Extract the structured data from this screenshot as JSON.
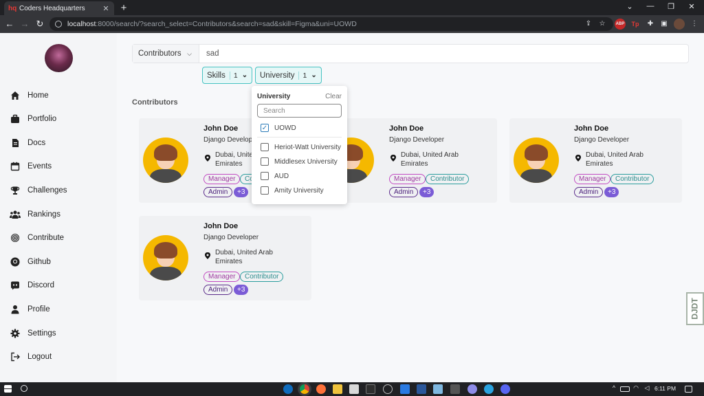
{
  "browser": {
    "tab_title": "Coders Headquarters",
    "tab_favicon": "hq",
    "url_host": "localhost",
    "url_rest": ":8000/search/?search_select=Contributors&search=sad&skill=Figma&uni=UOWD",
    "abp_label": "ABP",
    "tp_label": "Tp"
  },
  "sidebar": {
    "items": [
      {
        "label": "Home",
        "icon": "home-icon"
      },
      {
        "label": "Portfolio",
        "icon": "briefcase-icon"
      },
      {
        "label": "Docs",
        "icon": "document-icon"
      },
      {
        "label": "Events",
        "icon": "calendar-icon"
      },
      {
        "label": "Challenges",
        "icon": "trophy-icon"
      },
      {
        "label": "Rankings",
        "icon": "users-icon"
      },
      {
        "label": "Contribute",
        "icon": "fingerprint-icon"
      },
      {
        "label": "Github",
        "icon": "github-icon"
      },
      {
        "label": "Discord",
        "icon": "discord-icon"
      },
      {
        "label": "Profile",
        "icon": "person-icon"
      },
      {
        "label": "Settings",
        "icon": "gear-icon"
      },
      {
        "label": "Logout",
        "icon": "logout-icon"
      }
    ]
  },
  "search": {
    "select_value": "Contributors",
    "query": "sad"
  },
  "filters": {
    "skills_label": "Skills",
    "skills_count": "1",
    "university_label": "University",
    "university_count": "1"
  },
  "section_title": "Contributors",
  "cards": [
    {
      "name": "John Doe",
      "role": "Django Developer",
      "location": "Dubai, United Arab Emirates",
      "badges": [
        "Manager",
        "Contributor",
        "Admin",
        "+3"
      ]
    },
    {
      "name": "John Doe",
      "role": "Django Developer",
      "location": "Dubai, United Arab Emirates",
      "badges": [
        "Manager",
        "Contributor",
        "Admin",
        "+3"
      ]
    },
    {
      "name": "John Doe",
      "role": "Django Developer",
      "location": "Dubai, United Arab Emirates",
      "badges": [
        "Manager",
        "Contributor",
        "Admin",
        "+3"
      ]
    },
    {
      "name": "John Doe",
      "role": "Django Developer",
      "location": "Dubai, United Arab Emirates",
      "badges": [
        "Manager",
        "Contributor",
        "Admin",
        "+3"
      ]
    }
  ],
  "dropdown": {
    "title": "University",
    "clear_label": "Clear",
    "search_placeholder": "Search",
    "options": [
      {
        "label": "UOWD",
        "checked": true
      },
      {
        "label": "Heriot-Watt University",
        "checked": false
      },
      {
        "label": "Middlesex University",
        "checked": false
      },
      {
        "label": "AUD",
        "checked": false
      },
      {
        "label": "Amity University",
        "checked": false
      }
    ]
  },
  "debug_toolbar_label": "DJDT",
  "taskbar": {
    "time": "6:11 PM"
  },
  "colors": {
    "accent_teal": "#46c2c2",
    "manager": "#c24ac2",
    "contributor": "#2a9d9d",
    "admin": "#5a2a8a",
    "more": "#7b5cd6",
    "avatar_bg": "#f5b800"
  }
}
